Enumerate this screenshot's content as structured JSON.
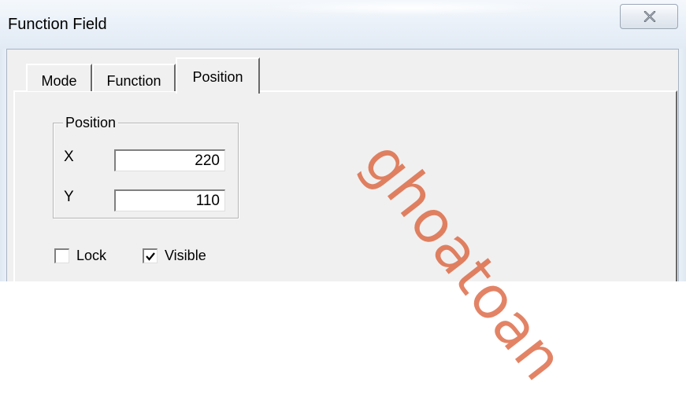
{
  "window": {
    "title": "Function Field"
  },
  "tabs": [
    {
      "label": "Mode",
      "active": false
    },
    {
      "label": "Function",
      "active": false
    },
    {
      "label": "Position",
      "active": true
    }
  ],
  "position_group": {
    "label": "Position",
    "x": {
      "label": "X",
      "value": "220"
    },
    "y": {
      "label": "Y",
      "value": "110"
    }
  },
  "options": {
    "lock": {
      "label": "Lock",
      "checked": false
    },
    "visible": {
      "label": "Visible",
      "checked": true
    }
  },
  "watermark": {
    "text": "ghoatoan"
  },
  "icons": {
    "close": "close-icon",
    "check": "checkmark-icon"
  },
  "colors": {
    "watermark": "#d9542a",
    "dialog_face": "#f0f0f0",
    "titlebar": "#e9f0f8"
  }
}
